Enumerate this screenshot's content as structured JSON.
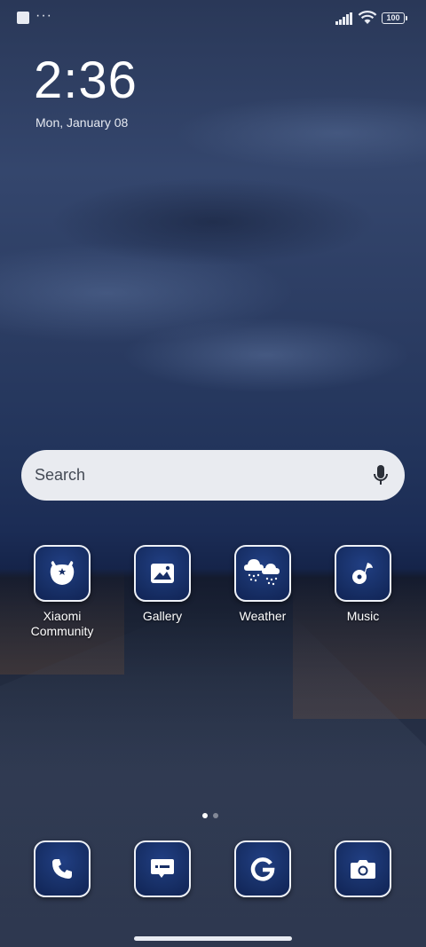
{
  "status_bar": {
    "left_icons": [
      "notification-square-icon",
      "more-dots-icon"
    ],
    "dots": "···",
    "battery": "100"
  },
  "clock": {
    "time": "2:36",
    "date": "Mon, January 08"
  },
  "search": {
    "placeholder": "Search"
  },
  "apps": [
    {
      "label": "Xiaomi Community",
      "icon": "xiaomi-community-icon"
    },
    {
      "label": "Gallery",
      "icon": "gallery-icon"
    },
    {
      "label": "Weather",
      "icon": "weather-icon"
    },
    {
      "label": "Music",
      "icon": "music-icon"
    }
  ],
  "dock": [
    {
      "icon": "phone-icon"
    },
    {
      "icon": "messages-icon"
    },
    {
      "icon": "google-icon"
    },
    {
      "icon": "camera-icon"
    }
  ],
  "page_indicator": {
    "pages": 2,
    "current": 1
  },
  "colors": {
    "icon_bg": "#172f66",
    "search_bg": "#e9ebf0"
  }
}
